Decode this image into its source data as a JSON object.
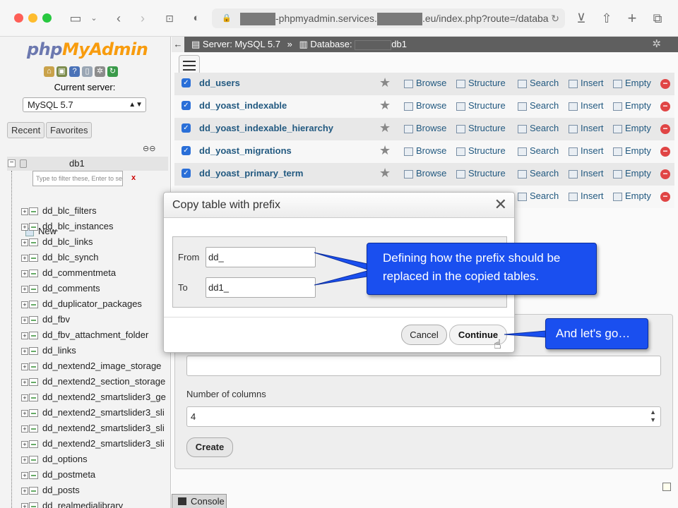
{
  "browser": {
    "url_prefix": "",
    "url_mid": "-phpmyadmin.services.",
    "url_suffix": ".eu/index.php?route=/databa"
  },
  "sidebar": {
    "logo_php": "php",
    "logo_admin": "MyAdmin",
    "current_server_label": "Current server:",
    "server_value": "MySQL 5.7",
    "tabs": [
      "Recent",
      "Favorites"
    ],
    "database": "db1",
    "filter_placeholder": "Type to filter these, Enter to se",
    "filter_clear": "x",
    "new_label": "New",
    "tables": [
      "dd_blc_filters",
      "dd_blc_instances",
      "dd_blc_links",
      "dd_blc_synch",
      "dd_commentmeta",
      "dd_comments",
      "dd_duplicator_packages",
      "dd_fbv",
      "dd_fbv_attachment_folder",
      "dd_links",
      "dd_nextend2_image_storage",
      "dd_nextend2_section_storage",
      "dd_nextend2_smartslider3_ge",
      "dd_nextend2_smartslider3_sli",
      "dd_nextend2_smartslider3_sli",
      "dd_nextend2_smartslider3_sli",
      "dd_options",
      "dd_postmeta",
      "dd_posts",
      "dd_realmedialibrary"
    ]
  },
  "topbar": {
    "server": "Server: MySQL 5.7",
    "sep": "»",
    "database_prefix": "Database:",
    "database_suffix": "db1"
  },
  "table_rows": [
    {
      "name": "dd_users"
    },
    {
      "name": "dd_yoast_indexable"
    },
    {
      "name": "dd_yoast_indexable_hierarchy"
    },
    {
      "name": "dd_yoast_migrations"
    },
    {
      "name": "dd_yoast_primary_term"
    },
    {
      "name": ""
    }
  ],
  "actions": {
    "browse": "Browse",
    "structure": "Structure",
    "search": "Search",
    "insert": "Insert",
    "empty": "Empty"
  },
  "create_table": {
    "ncols_label": "Number of columns",
    "ncols_value": "4",
    "create_label": "Create"
  },
  "console": {
    "label": "Console"
  },
  "modal": {
    "title": "Copy table with prefix",
    "from_label": "From",
    "from_value": "dd_",
    "to_label": "To",
    "to_value": "dd1_",
    "cancel_label": "Cancel",
    "continue_label": "Continue"
  },
  "callouts": {
    "prefix_note_line1": "Defining how the prefix should be",
    "prefix_note_line2": "replaced in the copied tables.",
    "go_note": "And let's go…"
  },
  "colors": {
    "callout_blue": "#1a4fef",
    "link_blue": "#235a81",
    "logo_blue": "#6c78af",
    "logo_orange": "#f89c0e"
  }
}
